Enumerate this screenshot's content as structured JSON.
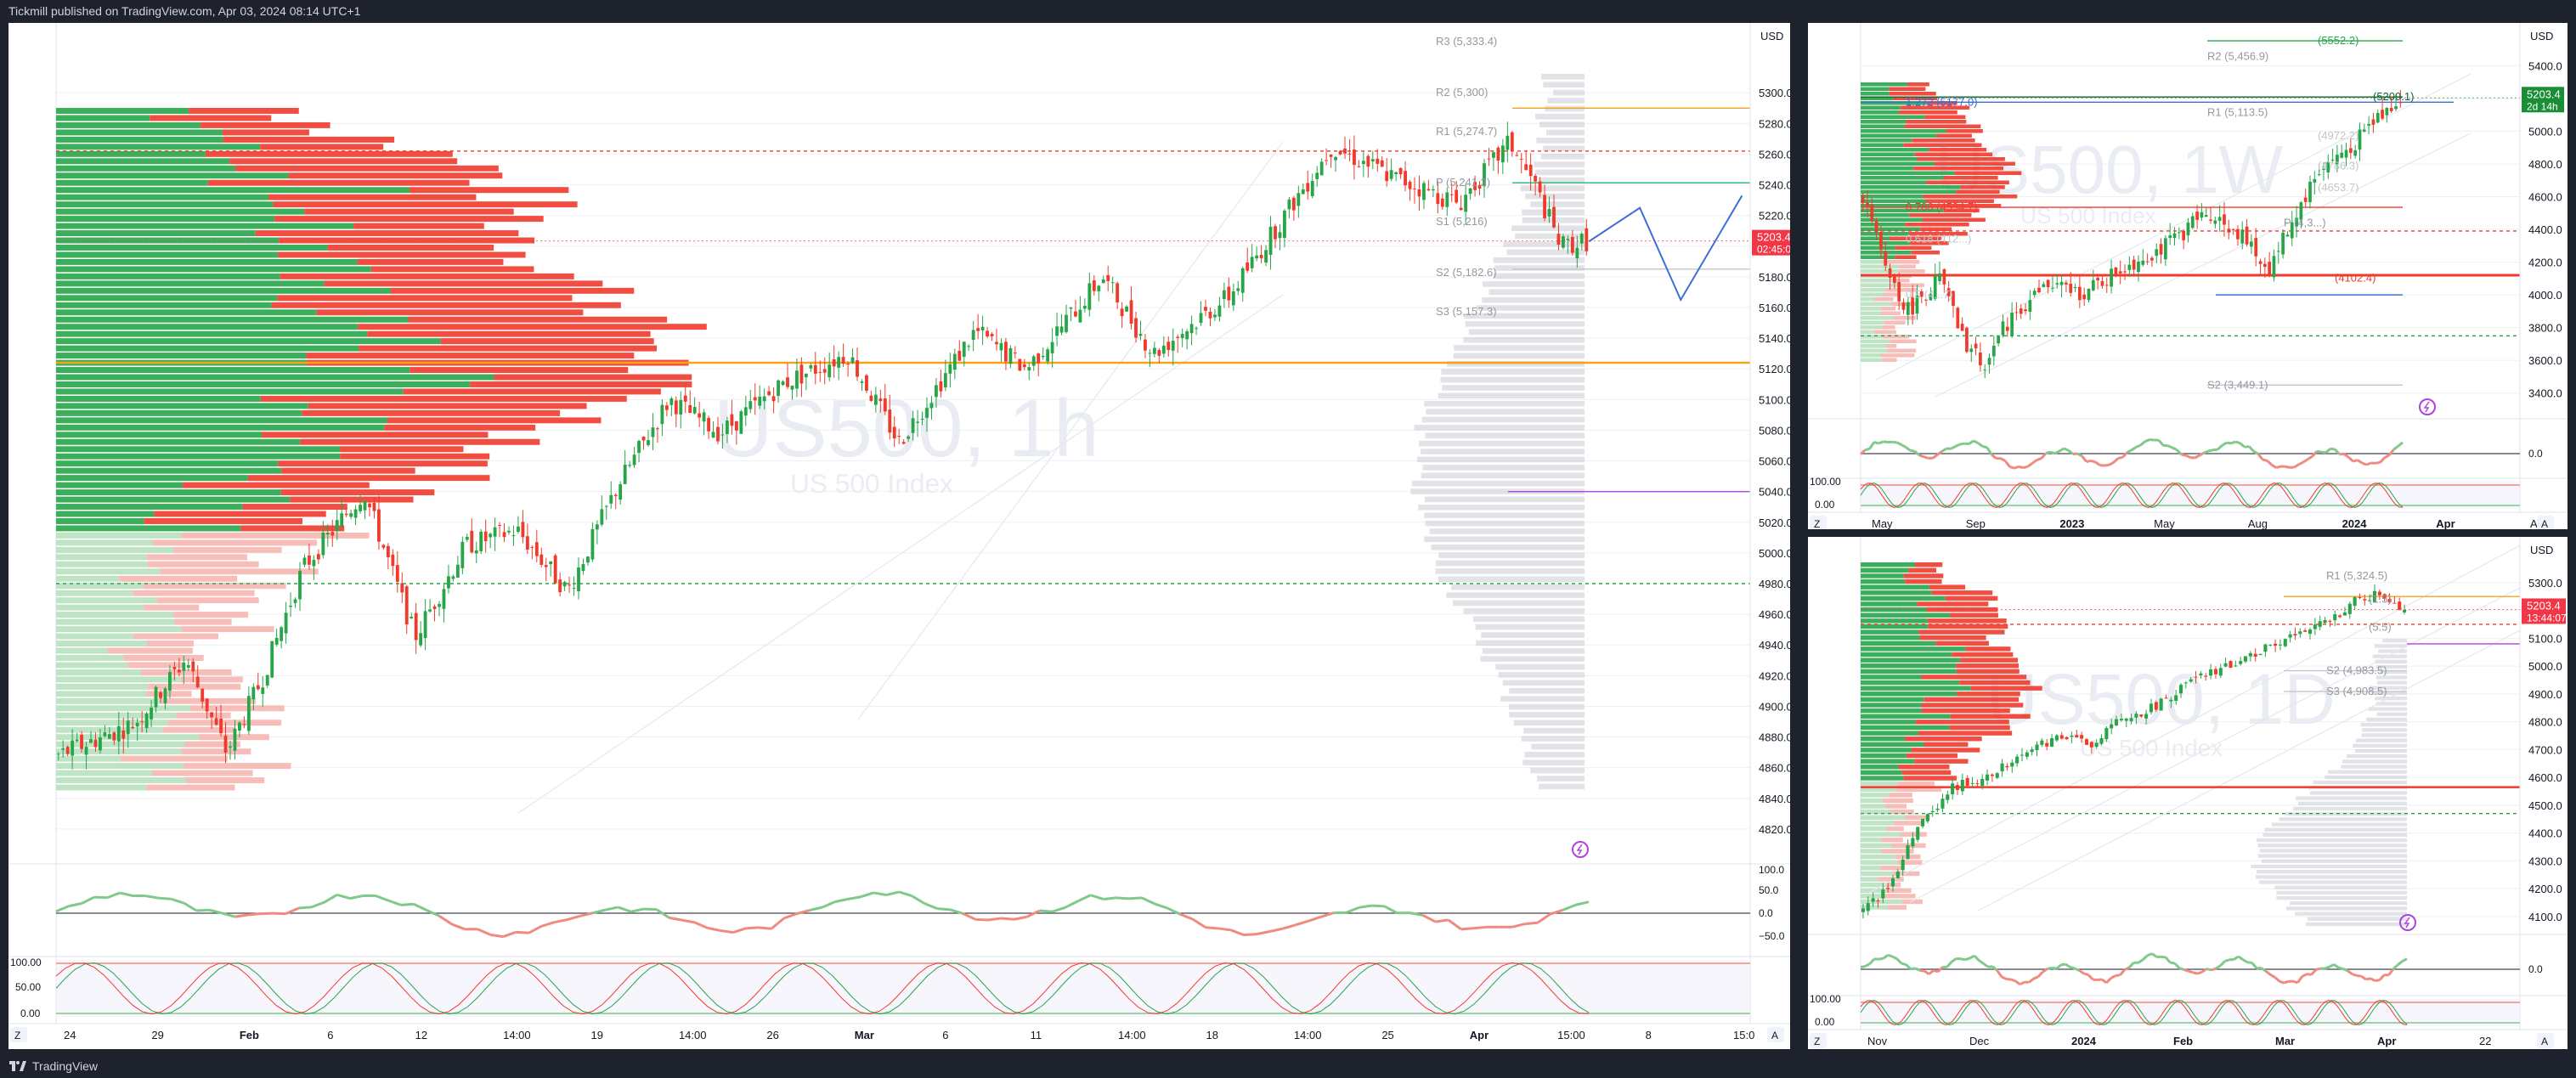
{
  "header": {
    "published_text": "Tickmill published on TradingView.com, Apr 03, 2024 08:14 UTC+1"
  },
  "footer": {
    "brand": "TradingView"
  },
  "colors": {
    "up": "#26a649",
    "down": "#ef3b2c",
    "orange": "#f7a21b",
    "blue": "#3b6fd6",
    "purple": "#b040e0",
    "grid": "#eef0f3"
  },
  "panels": {
    "main": {
      "currency": "USD",
      "watermark": "US500, 1h",
      "watermark_sub": "US 500 Index",
      "price_tag": "5203.4",
      "countdown": "02:45:08",
      "z_button": "Z",
      "a_button": "A",
      "pivot_labels": [
        "R3 (5,333.4)",
        "R2 (5,300)",
        "R1 (5,274.7)",
        "P (5,241.3)",
        "S1 (5,216)",
        "S2 (5,182.6)",
        "S3 (5,157.3)"
      ],
      "osc_labels": [
        "100.0",
        "50.0",
        "0.0",
        "−50.0"
      ],
      "stoch_labels": [
        "100.00",
        "50.00",
        "0.00"
      ],
      "x_labels": [
        "24",
        "29",
        "Feb",
        "6",
        "12",
        "14:00",
        "19",
        "14:00",
        "26",
        "Mar",
        "6",
        "11",
        "14:00",
        "18",
        "14:00",
        "25",
        "Apr",
        "15:00",
        "8",
        "15:0"
      ]
    },
    "weekly": {
      "currency": "USD",
      "watermark": "US500, 1W",
      "watermark_sub": "US 500 Index",
      "price_tag": "5203.4",
      "countdown": "2d 14h",
      "z_button": "Z",
      "a_button": "A",
      "labels": [
        "(5552.2)",
        "R2 (5,456.9)",
        "1.272 (5177.0)",
        "(5209.1)",
        "R1 (5,113.5)",
        "(4972.2)",
        "(4786.3)",
        "(4653.7)",
        "0.786 (4534.7)",
        "P (4,3...)",
        "0.618 (412...)",
        "(4102.4)",
        "0.5 (4...7)",
        "S2 (3,449.1)"
      ],
      "osc_labels": [
        "0.0",
        "100.00",
        "0.00"
      ],
      "x_labels": [
        "May",
        "Sep",
        "2023",
        "May",
        "Aug",
        "2024",
        "Apr",
        "Ap"
      ]
    },
    "daily": {
      "currency": "USD",
      "watermark": "US500, 1D",
      "watermark_sub": "US 500 Index",
      "price_tag": "5203.4",
      "countdown": "13:44:07",
      "z_button": "Z",
      "a_button": "A",
      "labels": [
        "R1 (5,324.5)",
        "(1.5)",
        "(5.5)",
        "S2 (4,983.5)",
        "S3 (4,908.5)"
      ],
      "osc_labels": [
        "0.0",
        "100.00",
        "0.00"
      ],
      "x_labels": [
        "Nov",
        "Dec",
        "2024",
        "Feb",
        "Mar",
        "Apr",
        "22"
      ]
    }
  },
  "chart_data": [
    {
      "type": "candlestick",
      "title": "US500, 1h",
      "symbol": "US 500 Index",
      "ylim": [
        4800,
        5340
      ],
      "y_ticks": [
        5300,
        5280,
        5260,
        5240,
        5220,
        5200,
        5180,
        5160,
        5140,
        5120,
        5100,
        5080,
        5060,
        5040,
        5020,
        5000,
        4980,
        4960,
        4940,
        4920,
        4900,
        4880,
        4860,
        4840,
        4820
      ],
      "last_price": 5203.4,
      "pivots": {
        "R3": 5333.4,
        "R2": 5300,
        "R1": 5274.7,
        "P": 5241.3,
        "S1": 5216,
        "S2": 5182.6,
        "S3": 5157.3
      },
      "close_path": [
        [
          0,
          4868
        ],
        [
          15,
          4889
        ],
        [
          25,
          4931
        ],
        [
          33,
          4870
        ],
        [
          40,
          4918
        ],
        [
          48,
          4990
        ],
        [
          60,
          5040
        ],
        [
          70,
          4945
        ],
        [
          80,
          5005
        ],
        [
          90,
          5015
        ],
        [
          100,
          4975
        ],
        [
          110,
          5045
        ],
        [
          120,
          5100
        ],
        [
          130,
          5078
        ],
        [
          142,
          5110
        ],
        [
          155,
          5130
        ],
        [
          165,
          5072
        ],
        [
          180,
          5145
        ],
        [
          190,
          5120
        ],
        [
          205,
          5180
        ],
        [
          215,
          5130
        ],
        [
          230,
          5168
        ],
        [
          250,
          5265
        ],
        [
          262,
          5245
        ],
        [
          275,
          5228
        ],
        [
          285,
          5268
        ],
        [
          290,
          5238
        ],
        [
          295,
          5200
        ],
        [
          300,
          5203
        ]
      ],
      "projection": [
        [
          300,
          5203
        ],
        [
          310,
          5225
        ],
        [
          318,
          5165
        ],
        [
          330,
          5233
        ]
      ],
      "x_ticks": [
        "24",
        "29",
        "Feb",
        "6",
        "12",
        "14:00",
        "19",
        "14:00",
        "26",
        "Mar",
        "6",
        "11",
        "14:00",
        "18",
        "14:00",
        "25",
        "Apr",
        "15:00",
        "8",
        "15:0"
      ]
    },
    {
      "type": "candlestick",
      "title": "US500, 1W",
      "ylim": [
        3300,
        5620
      ],
      "y_ticks": [
        5400,
        5200,
        5000,
        4800,
        4600,
        4400,
        4200,
        4000,
        3800,
        3600,
        3400
      ],
      "last_price": 5203.4,
      "levels": {
        "R2": 5456.9,
        "1.272": 5177.0,
        "R1": 5113.5,
        "0.786": 4534.7,
        "S2": 3449.1,
        "fib_top": 5552.2,
        "fib_5209": 5209.1,
        "fib_4102": 4102.4
      },
      "close_path": [
        [
          0,
          4600
        ],
        [
          10,
          4200
        ],
        [
          22,
          3900
        ],
        [
          38,
          4100
        ],
        [
          50,
          3700
        ],
        [
          60,
          3580
        ],
        [
          72,
          3850
        ],
        [
          90,
          4050
        ],
        [
          110,
          4010
        ],
        [
          130,
          4180
        ],
        [
          150,
          4300
        ],
        [
          170,
          4510
        ],
        [
          185,
          4380
        ],
        [
          200,
          4150
        ],
        [
          210,
          4420
        ],
        [
          225,
          4760
        ],
        [
          240,
          4900
        ],
        [
          255,
          5100
        ],
        [
          265,
          5209
        ]
      ],
      "x_ticks": [
        "May",
        "Sep",
        "2023",
        "May",
        "Aug",
        "2024",
        "Apr",
        "Ap"
      ]
    },
    {
      "type": "candlestick",
      "title": "US500, 1D",
      "ylim": [
        4060,
        5440
      ],
      "y_ticks": [
        5300,
        5200,
        5100,
        5000,
        4900,
        4800,
        4700,
        4600,
        4500,
        4400,
        4300,
        4200,
        4100
      ],
      "last_price": 5203.4,
      "levels": {
        "R1": 5324.5,
        "S2": 4983.5,
        "S3": 4908.5
      },
      "close_path": [
        [
          0,
          4120
        ],
        [
          10,
          4200
        ],
        [
          20,
          4400
        ],
        [
          35,
          4560
        ],
        [
          50,
          4610
        ],
        [
          65,
          4700
        ],
        [
          80,
          4750
        ],
        [
          90,
          4720
        ],
        [
          100,
          4790
        ],
        [
          115,
          4850
        ],
        [
          130,
          4940
        ],
        [
          145,
          5000
        ],
        [
          160,
          5070
        ],
        [
          175,
          5120
        ],
        [
          185,
          5160
        ],
        [
          195,
          5230
        ],
        [
          205,
          5260
        ],
        [
          215,
          5205
        ]
      ],
      "x_ticks": [
        "Nov",
        "Dec",
        "2024",
        "Feb",
        "Mar",
        "Apr",
        "22"
      ]
    }
  ]
}
